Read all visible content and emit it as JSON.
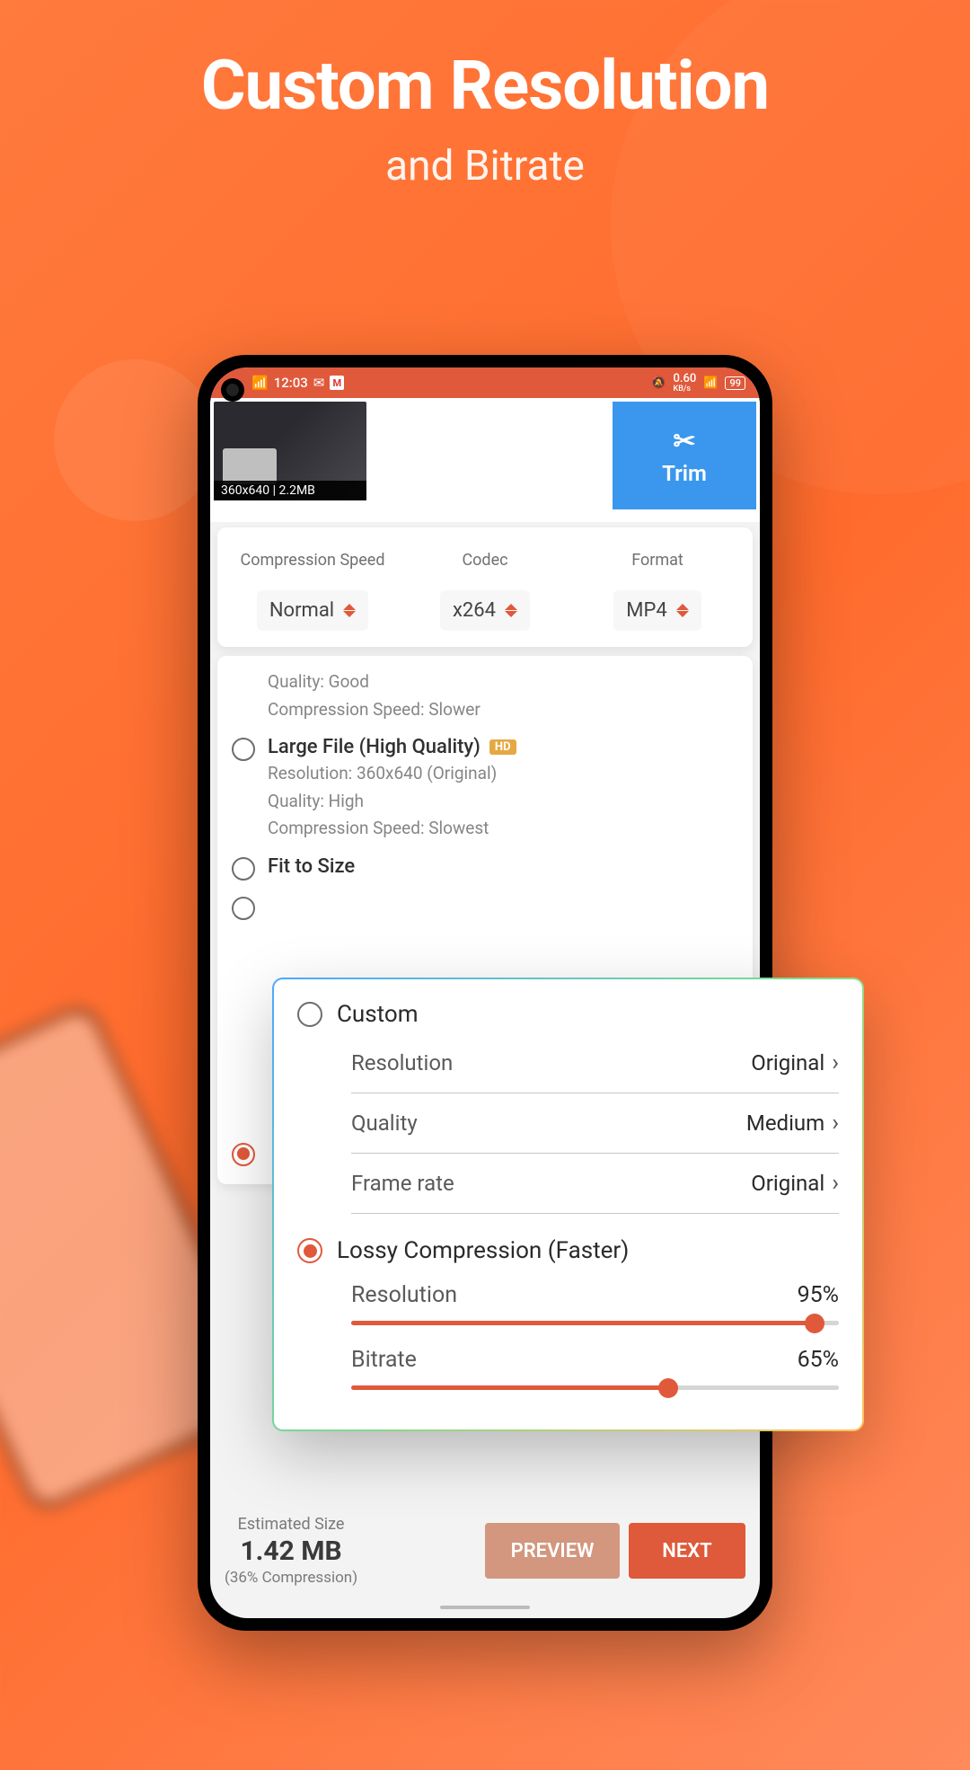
{
  "hero": {
    "title": "Custom Resolution",
    "subtitle": "and Bitrate"
  },
  "statusbar": {
    "time": "12:03",
    "net": "0.60",
    "battery": "99"
  },
  "thumbnail": {
    "info": "360x640 | 2.2MB"
  },
  "trim": {
    "label": "Trim"
  },
  "options": {
    "speed": {
      "label": "Compression Speed",
      "value": "Normal"
    },
    "codec": {
      "label": "Codec",
      "value": "x264"
    },
    "format": {
      "label": "Format",
      "value": "MP4"
    }
  },
  "presets": {
    "partial": {
      "quality": "Quality: Good",
      "speed": "Compression Speed: Slower"
    },
    "large": {
      "title": "Large File (High Quality)",
      "hd": "HD",
      "resolution": "Resolution: 360x640 (Original)",
      "quality": "Quality: High",
      "speed": "Compression Speed: Slowest"
    },
    "fit": {
      "title": "Fit to Size"
    }
  },
  "overlay": {
    "custom": {
      "title": "Custom",
      "resolution": {
        "label": "Resolution",
        "value": "Original"
      },
      "quality": {
        "label": "Quality",
        "value": "Medium"
      },
      "framerate": {
        "label": "Frame rate",
        "value": "Original"
      }
    },
    "lossy": {
      "title": "Lossy Compression (Faster)",
      "resolution": {
        "label": "Resolution",
        "value": "95%",
        "percent": 95
      },
      "bitrate": {
        "label": "Bitrate",
        "value": "65%",
        "percent": 65
      }
    }
  },
  "footer": {
    "estLabel": "Estimated Size",
    "estSize": "1.42 MB",
    "estComp": "(36% Compression)",
    "preview": "PREVIEW",
    "next": "NEXT"
  }
}
